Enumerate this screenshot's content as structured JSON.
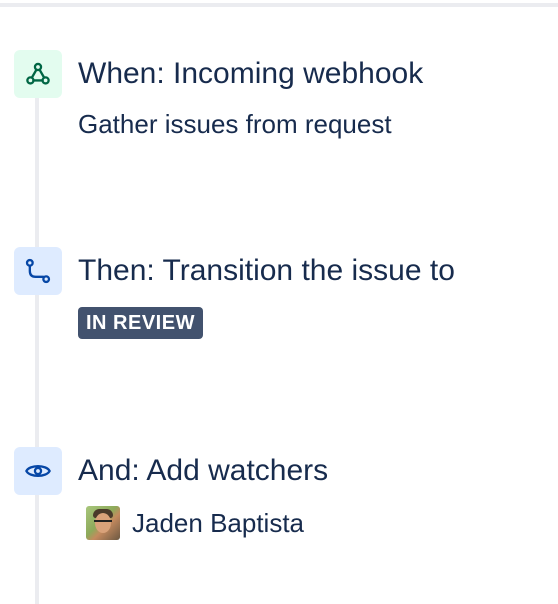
{
  "steps": [
    {
      "kind": "trigger",
      "icon": "webhook-icon",
      "title": "When: Incoming webhook",
      "subtitle": "Gather issues from request",
      "accent": "#006644",
      "icon_bg": "#e3fcef"
    },
    {
      "kind": "action",
      "icon": "transition-icon",
      "title": "Then: Transition the issue to",
      "status": "IN REVIEW",
      "accent": "#0747a6",
      "icon_bg": "#deebff"
    },
    {
      "kind": "action",
      "icon": "eye-icon",
      "title": "And: Add watchers",
      "watcher": {
        "name": "Jaden Baptista"
      },
      "accent": "#0747a6",
      "icon_bg": "#deebff"
    }
  ]
}
